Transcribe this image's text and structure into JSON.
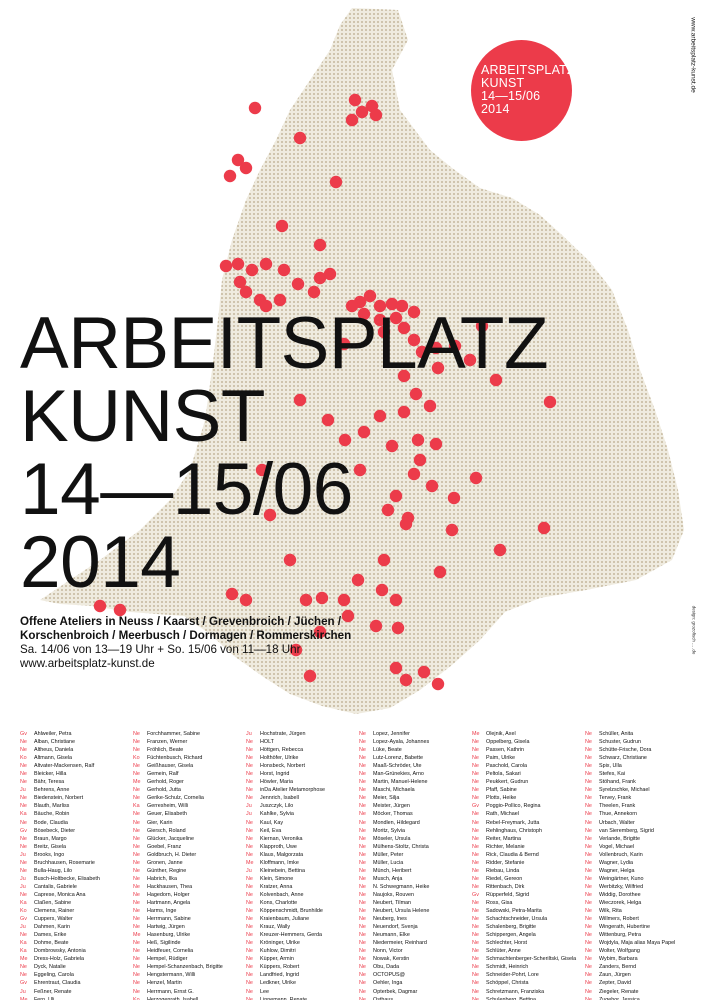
{
  "colors": {
    "accent": "#ec3b4a",
    "map_fill": "#efebdf",
    "map_dots": "#b8a98a",
    "text": "#111111"
  },
  "badge": {
    "lines": [
      "ARBEITSPLATZ",
      "KUNST",
      "14—15/06",
      "2014"
    ]
  },
  "side_url": "www.arbeitsplatz-kunst.de",
  "side_credit": "design: grozofisch ... .de",
  "headline": {
    "line1": "ARBEITSPLATZ",
    "line2": "KUNST",
    "line3": "14—15/06",
    "line4": "2014"
  },
  "info": {
    "line1": "Offene Ateliers in Neuss / Kaarst / Grevenbroich / Jüchen /",
    "line2": "Korschenbroich / Meerbusch / Dormagen / Rommerskirchen",
    "line3": "Sa. 14/06 von 13—19 Uhr + So. 15/06 von 11—18 Uhr",
    "line4": "www.arbeitsplatz-kunst.de"
  },
  "names": [
    [
      [
        "Gv",
        "Ahlweiler, Petra"
      ],
      [
        "Ne",
        "Alban, Christiane"
      ],
      [
        "Ne",
        "Altheus, Daniela"
      ],
      [
        "Ko",
        "Altmann, Gisela"
      ],
      [
        "Ne",
        "Altvater-Mackensen, Ralf"
      ],
      [
        "Ne",
        "Bleicker, Hilla"
      ],
      [
        "Ne",
        "Bähr, Teresa"
      ],
      [
        "Ju",
        "Behrens, Anne"
      ],
      [
        "Ne",
        "Biedenstein, Norbert"
      ],
      [
        "Ne",
        "Blauth, Marliss"
      ],
      [
        "Ka",
        "Bäuche, Robin"
      ],
      [
        "Ne",
        "Bode, Claudia"
      ],
      [
        "Gv",
        "Bösebeck, Dieter"
      ],
      [
        "Ne",
        "Braun, Margo"
      ],
      [
        "Ne",
        "Breitz, Gisela"
      ],
      [
        "Ju",
        "Brooks, Ingo"
      ],
      [
        "Ne",
        "Bruchhausen, Rosemarie"
      ],
      [
        "Ne",
        "Bulla-Haug, Lilo"
      ],
      [
        "Ju",
        "Busch-Holtbecke, Elisabeth"
      ],
      [
        "Ju",
        "Cantalis, Gabriele"
      ],
      [
        "Ne",
        "Caprese, Monica Ana"
      ],
      [
        "Ka",
        "Claßen, Sabine"
      ],
      [
        "Ko",
        "Clemens, Rainer"
      ],
      [
        "Gv",
        "Cuppers, Walter"
      ],
      [
        "Ju",
        "Dahmen, Karin"
      ],
      [
        "Ne",
        "Dames, Erike"
      ],
      [
        "Ka",
        "Dohme, Beate"
      ],
      [
        "Ka",
        "Dombrowsky, Antonia"
      ],
      [
        "Me",
        "Dress-Holz, Gabriela"
      ],
      [
        "Ne",
        "Dyck, Natalie"
      ],
      [
        "Ne",
        "Eggeling, Carola"
      ],
      [
        "Gv",
        "Ehrentraut, Claudia"
      ],
      [
        "Ju",
        "Feßner, Renate"
      ],
      [
        "Me",
        "Fern, Uli"
      ]
    ],
    [
      [
        "Ne",
        "Forchhammer, Sabine"
      ],
      [
        "Ne",
        "Franzen, Werner"
      ],
      [
        "Ne",
        "Fröhlich, Beate"
      ],
      [
        "Ko",
        "Füchtenbusch, Richard"
      ],
      [
        "Ne",
        "Geißhauser, Gisela"
      ],
      [
        "Ne",
        "Gemein, Ralf"
      ],
      [
        "Me",
        "Gerhold, Roger"
      ],
      [
        "Ne",
        "Gerhold, Jutta"
      ],
      [
        "Ne",
        "Gerike-Schulz, Cornelia"
      ],
      [
        "Ka",
        "Gerresheim, Willi"
      ],
      [
        "Ne",
        "Geuer, Elisabeth"
      ],
      [
        "Ne",
        "Gier, Karin"
      ],
      [
        "Ne",
        "Giersch, Roland"
      ],
      [
        "Ne",
        "Glücker, Jacqueline"
      ],
      [
        "Ne",
        "Goebel, Franz"
      ],
      [
        "Ne",
        "Goldbruch, H. Dieter"
      ],
      [
        "Ne",
        "Gronen, Janne"
      ],
      [
        "Ne",
        "Günther, Regine"
      ],
      [
        "Ne",
        "Habrich, Ilka"
      ],
      [
        "Ne",
        "Hackhausen, Thea"
      ],
      [
        "Ne",
        "Hagedorn, Holger"
      ],
      [
        "Ne",
        "Hartmann, Angela"
      ],
      [
        "Ne",
        "Harms, Inge"
      ],
      [
        "Ne",
        "Herrmann, Sabine"
      ],
      [
        "Ne",
        "Hartwig, Jürgen"
      ],
      [
        "Me",
        "Hasenburg, Ulrike"
      ],
      [
        "Ne",
        "Heß, Sigilinde"
      ],
      [
        "Ne",
        "Heidfeuer, Cornelia"
      ],
      [
        "Ne",
        "Hempel, Rüdiger"
      ],
      [
        "Ne",
        "Hempel-Schanzenbach, Brigitte"
      ],
      [
        "Ne",
        "Hengstermann, Willi"
      ],
      [
        "Ne",
        "Henzel, Martin"
      ],
      [
        "Ne",
        "Herrmann, Ernst G."
      ],
      [
        "Ko",
        "Herzogenrath, Isabell"
      ]
    ],
    [
      [
        "Ju",
        "Hochstrate, Jürgen"
      ],
      [
        "Ne",
        "HOLT"
      ],
      [
        "Ne",
        "Höttgen, Rebecca"
      ],
      [
        "Ne",
        "Holthöfer, Ulrike"
      ],
      [
        "Ne",
        "Honsbeck, Norbert"
      ],
      [
        "Ne",
        "Horst, Ingrid"
      ],
      [
        "Ne",
        "Höwler, Maria"
      ],
      [
        "Ne",
        "inDa Atelier Metamorphose"
      ],
      [
        "Ne",
        "Jennrich, Isabell"
      ],
      [
        "Ju",
        "Juszczyk, Lilo"
      ],
      [
        "Ju",
        "Kahlke, Sylvia"
      ],
      [
        "Ne",
        "Kaul, Kay"
      ],
      [
        "Ne",
        "Keil, Eva"
      ],
      [
        "Ne",
        "Kiernan, Veronika"
      ],
      [
        "Ne",
        "Klapproth, Uwe"
      ],
      [
        "Ne",
        "Klaus, Malgorzata"
      ],
      [
        "Me",
        "Kloffmann, Imke"
      ],
      [
        "Ju",
        "Kleinebein, Bettina"
      ],
      [
        "Ne",
        "Klein, Simone"
      ],
      [
        "Ne",
        "Kratzer, Anna"
      ],
      [
        "Ne",
        "Kolvenbach, Anne"
      ],
      [
        "Ne",
        "Kons, Charlotte"
      ],
      [
        "Ne",
        "Köppenschmidt, Brunhilde"
      ],
      [
        "Ne",
        "Kraienbaum, Juliane"
      ],
      [
        "Ne",
        "Krauz, Wally"
      ],
      [
        "Ne",
        "Kreuzer-Hemmers, Gerda"
      ],
      [
        "Ne",
        "Kröninger, Ulrike"
      ],
      [
        "Ne",
        "Kuhlow, Dimitri"
      ],
      [
        "Ne",
        "Küpper, Armin"
      ],
      [
        "Ne",
        "Küppers, Robert"
      ],
      [
        "Ne",
        "Landfried, Ingrid"
      ],
      [
        "Ne",
        "Ledkner, Ulrike"
      ],
      [
        "Ne",
        "Lee"
      ],
      [
        "Ne",
        "Linnemann, Renate"
      ]
    ],
    [
      [
        "Ne",
        "Lopez, Jennifer"
      ],
      [
        "Ne",
        "Lopez-Ayala, Johannes"
      ],
      [
        "Ne",
        "Lüke, Beate"
      ],
      [
        "Ne",
        "Lutz-Lorenz, Babette"
      ],
      [
        "Ne",
        "Maaß-Schröder, Ute"
      ],
      [
        "Ne",
        "Man-Grünekies, Arno"
      ],
      [
        "Ne",
        "Martin, Manuel-Helene"
      ],
      [
        "Ne",
        "Maschi, Michaela"
      ],
      [
        "Ne",
        "Meier, Silja"
      ],
      [
        "Ne",
        "Meister, Jürgen"
      ],
      [
        "Ne",
        "Möcker, Thomas"
      ],
      [
        "Ne",
        "Mondlen, Hildegard"
      ],
      [
        "Ne",
        "Moritz, Sylvia"
      ],
      [
        "Ne",
        "Möseler, Ursula"
      ],
      [
        "Ne",
        "Mülhens-Stoltz, Christa"
      ],
      [
        "Ne",
        "Müller, Peter"
      ],
      [
        "Ne",
        "Müller, Lucia"
      ],
      [
        "Ne",
        "Münch, Heribert"
      ],
      [
        "Ne",
        "Musch, Anja"
      ],
      [
        "Ne",
        "N. Schwegmann, Heike"
      ],
      [
        "Ne",
        "Naujoks, Rouven"
      ],
      [
        "Ne",
        "Neubert, Tilman"
      ],
      [
        "Ne",
        "Neubert, Ursula Helene"
      ],
      [
        "Ne",
        "Neuberg, Ines"
      ],
      [
        "Ne",
        "Neuendorf, Svenja"
      ],
      [
        "Ne",
        "Neumann, Elke"
      ],
      [
        "Ne",
        "Niedermeier, Reinhard"
      ],
      [
        "Ne",
        "Nonn, Victor"
      ],
      [
        "Ne",
        "Nowak, Kerstin"
      ],
      [
        "Ne",
        "Obu, Dada"
      ],
      [
        "Ne",
        "OCTOPUS@"
      ],
      [
        "Ne",
        "Oehler, Inga"
      ],
      [
        "Ne",
        "Opterbek, Dagmar"
      ],
      [
        "Ne",
        "Osthaus"
      ]
    ],
    [
      [
        "Me",
        "Olejnik, Axel"
      ],
      [
        "Ne",
        "Oppelberg, Gisela"
      ],
      [
        "Ne",
        "Passen, Kathrin"
      ],
      [
        "Ne",
        "Paim, Ulrike"
      ],
      [
        "Ne",
        "Paschold, Carola"
      ],
      [
        "Ne",
        "Peltola, Sakari"
      ],
      [
        "Ne",
        "Peukkert, Gudrun"
      ],
      [
        "Ne",
        "Pfaff, Sabine"
      ],
      [
        "Ne",
        "Plotts, Heike"
      ],
      [
        "Gv",
        "Poggio-Pollico, Regina"
      ],
      [
        "Ne",
        "Rath, Michael"
      ],
      [
        "Ne",
        "Rebel-Freymark, Jutta"
      ],
      [
        "Ne",
        "Rehlinghaus, Christoph"
      ],
      [
        "Ne",
        "Reiter, Martina"
      ],
      [
        "Ne",
        "Richter, Melanie"
      ],
      [
        "Ne",
        "Rick, Claudia & Bernd"
      ],
      [
        "Ne",
        "Ridder, Stefanie"
      ],
      [
        "Ne",
        "Riebau, Linda"
      ],
      [
        "Ne",
        "Riedel, Gereon"
      ],
      [
        "Ne",
        "Rittenbach, Dirk"
      ],
      [
        "Gv",
        "Rüpperfeld, Sigrid"
      ],
      [
        "Ne",
        "Ross, Gisa"
      ],
      [
        "Ne",
        "Sadowski, Petra-Marita"
      ],
      [
        "Ne",
        "Schachtschneider, Ursula"
      ],
      [
        "Ne",
        "Schalenberg, Brigitte"
      ],
      [
        "Ne",
        "Schippergen, Angela"
      ],
      [
        "Ne",
        "Schlechter, Horst"
      ],
      [
        "Ne",
        "Schlüter, Anne"
      ],
      [
        "Ne",
        "Schmachtenberger-Scheriltski, Gisela"
      ],
      [
        "Ne",
        "Schmidt, Heinrich"
      ],
      [
        "Ne",
        "Schneider-Pohrt, Lore"
      ],
      [
        "Ne",
        "Schöppel, Christa"
      ],
      [
        "Ne",
        "Schretzmann, Franziska"
      ],
      [
        "Ne",
        "Schulenberg, Bettina"
      ]
    ],
    [
      [
        "Ne",
        "Schüller, Anita"
      ],
      [
        "Ne",
        "Schuster, Gudrun"
      ],
      [
        "Ne",
        "Schütte-Frische, Dora"
      ],
      [
        "Ne",
        "Schwarz, Christiane"
      ],
      [
        "Ne",
        "Spix, Ulla"
      ],
      [
        "Ne",
        "Stefes, Kai"
      ],
      [
        "Ne",
        "Stöhand, Frank"
      ],
      [
        "Ne",
        "Syrelzschke, Michael"
      ],
      [
        "Ne",
        "Tervey, Frank"
      ],
      [
        "Ne",
        "Theelen, Frank"
      ],
      [
        "Ne",
        "Thue, Annekorn"
      ],
      [
        "Ne",
        "Urbach, Walter"
      ],
      [
        "Ne",
        "van Sieremberg, Sigrid"
      ],
      [
        "Ne",
        "Verlande, Brigitte"
      ],
      [
        "Ne",
        "Vogel, Michael"
      ],
      [
        "Ne",
        "Vollenbruch, Karin"
      ],
      [
        "Ne",
        "Wagner, Lydia"
      ],
      [
        "Ne",
        "Wagner, Helga"
      ],
      [
        "Ne",
        "Weingärtner, Kuno"
      ],
      [
        "Ne",
        "Werbitzky, Wilfried"
      ],
      [
        "Ne",
        "Widdig, Dorothee"
      ],
      [
        "Ne",
        "Wieczorek, Helga"
      ],
      [
        "Ne",
        "Wilk, Rita"
      ],
      [
        "Ne",
        "Willmers, Robert"
      ],
      [
        "Ne",
        "Wingerath, Hubertine"
      ],
      [
        "Ne",
        "Wittenburg, Petra"
      ],
      [
        "Ne",
        "Wojdyla, Maja alias Maya Papel"
      ],
      [
        "Ne",
        "Wolter, Wolfgang"
      ],
      [
        "Ne",
        "Wybim, Barbara"
      ],
      [
        "Ne",
        "Zanders, Bernd"
      ],
      [
        "Ne",
        "Zaun, Jürgen"
      ],
      [
        "Ne",
        "Zepter, David"
      ],
      [
        "Ne",
        "Ziegeler, Renate"
      ],
      [
        "Ne",
        "Zugehor, Jessica"
      ]
    ]
  ]
}
